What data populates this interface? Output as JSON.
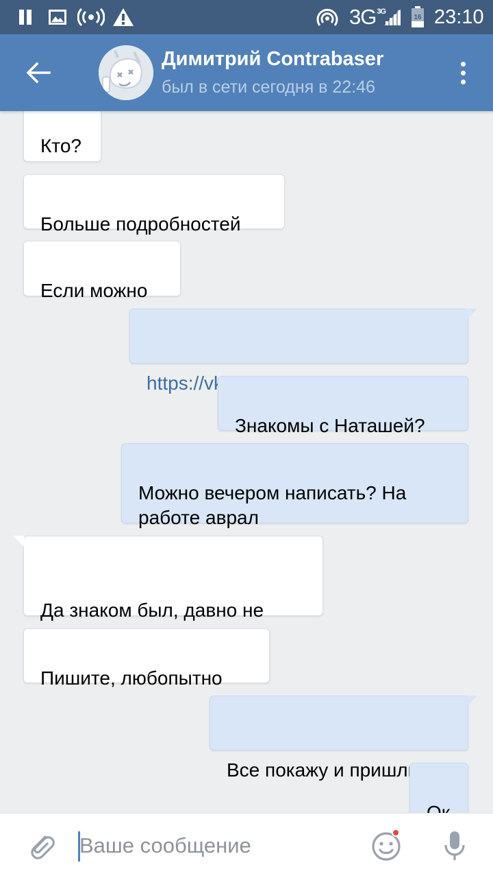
{
  "status_bar": {
    "network_type": "3G",
    "network_small": "3G",
    "battery_level": "16",
    "time": "23:10",
    "icons": [
      "pause-icon",
      "image-icon",
      "hotspot-icon",
      "warning-icon",
      "cast-icon",
      "signal-icon",
      "battery-icon"
    ]
  },
  "header": {
    "contact_name": "Димитрий Contrabaser",
    "contact_status": "был в сети сегодня в 22:46",
    "icons": [
      "back-arrow-icon",
      "avatar-image",
      "more-vertical-icon"
    ]
  },
  "messages": [
    {
      "direction": "in",
      "text": "Кто?"
    },
    {
      "direction": "in",
      "text": "Больше подробностей"
    },
    {
      "direction": "in",
      "text": "Если можно"
    },
    {
      "direction": "out",
      "text": "https://vk.com/n.chebaevskaya",
      "is_link": true
    },
    {
      "direction": "out",
      "text": "Знакомы с Наташей?"
    },
    {
      "direction": "out",
      "text": "Можно вечером написать? На\nработе аврал"
    },
    {
      "direction": "in",
      "text": "Да знаком был,  давно не\nпересекались"
    },
    {
      "direction": "in",
      "text": "Пишите,  любопытно"
    },
    {
      "direction": "out",
      "text": "Все покажу и пришлю"
    },
    {
      "direction": "out",
      "text": "Ок"
    }
  ],
  "composer": {
    "placeholder": "Ваше сообщение",
    "value": "",
    "icons": [
      "attach-icon",
      "emoji-icon",
      "microphone-icon"
    ]
  },
  "colors": {
    "status_bar": "#405c7f",
    "header": "#5181b8",
    "background": "#edeef0",
    "incoming_bubble": "#ffffff",
    "outgoing_bubble": "#d8e6f8",
    "link": "#3b6ea5",
    "notification_dot": "#e64646"
  }
}
